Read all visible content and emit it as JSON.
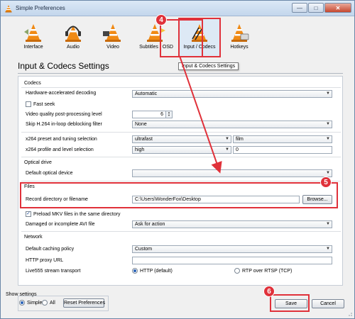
{
  "window": {
    "title": "Simple Preferences",
    "controls": [
      "—",
      "□",
      "✕"
    ]
  },
  "toolbar": {
    "items": [
      {
        "label": "Interface",
        "icon": "interface-cone-icon"
      },
      {
        "label": "Audio",
        "icon": "audio-cone-headphones-icon"
      },
      {
        "label": "Video",
        "icon": "video-cone-icon"
      },
      {
        "label": "Subtitles / OSD",
        "icon": "subtitles-cone-icon"
      },
      {
        "label": "Input / Codecs",
        "icon": "input-codecs-cone-icon"
      },
      {
        "label": "Hotkeys",
        "icon": "hotkeys-cone-icon"
      }
    ],
    "active_index": 4
  },
  "page_title": "Input & Codecs Settings",
  "tooltip": "Input & Codecs Settings",
  "sections": {
    "codecs": {
      "title": "Codecs",
      "hw_decoding_label": "Hardware-accelerated decoding",
      "hw_decoding_value": "Automatic",
      "fast_seek_label": "Fast seek",
      "fast_seek_checked": false,
      "vq_label": "Video quality post-processing level",
      "vq_value": "6",
      "skip_label": "Skip H.264 in-loop deblocking filter",
      "skip_value": "None",
      "x264_preset_label": "x264 preset and tuning selection",
      "x264_preset_value": "ultrafast",
      "x264_tune_value": "film",
      "x264_profile_label": "x264 profile and level selection",
      "x264_profile_value": "high",
      "x264_level_value": "0"
    },
    "optical": {
      "title": "Optical drive",
      "device_label": "Default optical device",
      "device_value": ""
    },
    "files": {
      "title": "Files",
      "record_label": "Record directory or filename",
      "record_value": "C:\\Users\\WonderFox\\Desktop",
      "browse_label": "Browse...",
      "preload_label": "Preload MKV files in the same directory",
      "preload_checked": true,
      "damaged_label": "Damaged or incomplete AVI file",
      "damaged_value": "Ask for action"
    },
    "network": {
      "title": "Network",
      "caching_label": "Default caching policy",
      "caching_value": "Custom",
      "proxy_label": "HTTP proxy URL",
      "proxy_value": "",
      "live555_label": "Live555 stream transport",
      "transport_http": "HTTP (default)",
      "transport_rtp": "RTP over RTSP (TCP)",
      "transport_selected": "HTTP (default)"
    }
  },
  "footer": {
    "show_settings_label": "Show settings",
    "simple_label": "Simple",
    "all_label": "All",
    "mode_selected": "Simple",
    "reset_label": "Reset Preferences",
    "save_label": "Save",
    "cancel_label": "Cancel"
  },
  "annotations": {
    "step_input": "4",
    "step_files": "5",
    "step_save": "6",
    "highlight_color": "#e0313a"
  }
}
